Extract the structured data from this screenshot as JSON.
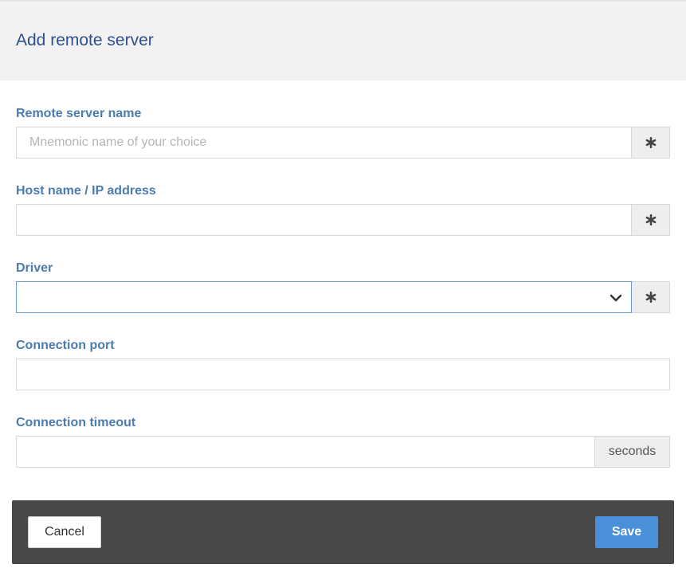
{
  "dialog": {
    "title": "Add remote server"
  },
  "fields": {
    "server_name": {
      "label": "Remote server name",
      "value": "",
      "placeholder": "Mnemonic name of your choice",
      "required_icon": "asterisk-icon"
    },
    "host": {
      "label": "Host name / IP address",
      "value": "",
      "placeholder": "",
      "required_icon": "asterisk-icon"
    },
    "driver": {
      "label": "Driver",
      "selected": "",
      "icon": "chevron-down-icon",
      "required_icon": "asterisk-icon"
    },
    "port": {
      "label": "Connection port",
      "value": "",
      "placeholder": ""
    },
    "timeout": {
      "label": "Connection timeout",
      "value": "",
      "placeholder": "",
      "unit": "seconds"
    }
  },
  "footer": {
    "cancel_label": "Cancel",
    "save_label": "Save"
  },
  "colors": {
    "header_bg": "#f2f2f2",
    "title": "#2f4f8f",
    "label": "#4a7cb0",
    "footer_bg": "#484848",
    "save_bg": "#4a90d9",
    "select_border": "#6b9bd0"
  }
}
